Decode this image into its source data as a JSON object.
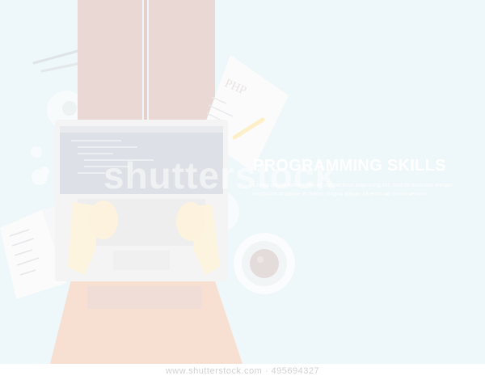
{
  "headline": "PROGRAMMING SKILLS",
  "subtitle_line1": "Lorem ipsum dolor sit amet, consectetur adipiscing elit. Sed do eiusmod tempor",
  "subtitle_line2": "incididunt ut labore et dolore magna aliqua. Ut enim ad minim veniam",
  "paper_label": "PHP",
  "watermark": "shutterstock",
  "footer": "www.shutterstock.com · 495694327",
  "colors": {
    "background": "#eef7f9",
    "legs": "#ead8d5",
    "shirt": "#f7e0d2",
    "skin": "#fdf4e0",
    "laptop_frame": "#f4f4f4",
    "screen": "#dde0e6",
    "paper": "#fbfbfb",
    "pencil": "#fdf0c8"
  }
}
